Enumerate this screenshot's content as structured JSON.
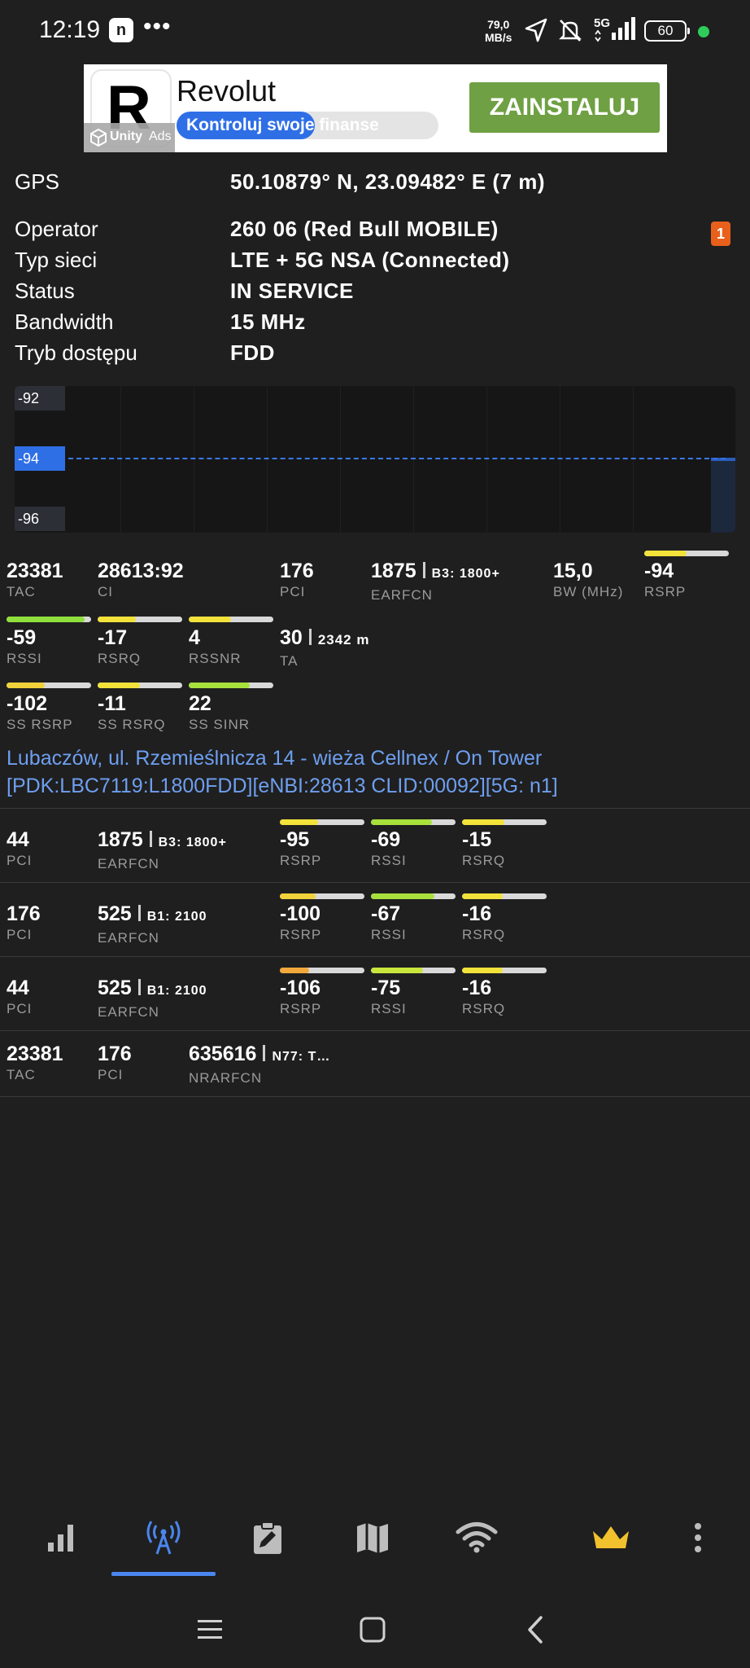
{
  "status_bar": {
    "time": "12:19",
    "app_icon_text": "n",
    "more": "•••",
    "speed_value": "79,0",
    "speed_unit": "MB/s",
    "network_label": "5G",
    "battery": "60",
    "icons": [
      "location-arrow-icon",
      "mute-icon",
      "signal-icon"
    ]
  },
  "ad": {
    "logo_letter": "R",
    "title": "Revolut",
    "tagline_a": "Kontroluj swoje",
    "tagline_b": " finanse",
    "badge_brand": "Unity",
    "badge_suffix": "Ads",
    "install_label": "ZAINSTALUJ",
    "install_color": "#6fa043"
  },
  "info": {
    "gps_label": "GPS",
    "gps_value": "50.10879° N, 23.09482° E (7 m)",
    "rows": [
      {
        "label": "Operator",
        "value": "260 06 (Red Bull MOBILE)"
      },
      {
        "label": "Typ sieci",
        "value": "LTE + 5G NSA (Connected)"
      },
      {
        "label": "Status",
        "value": "IN SERVICE"
      },
      {
        "label": "Bandwidth",
        "value": "15 MHz"
      },
      {
        "label": "Tryb dostępu",
        "value": "FDD"
      }
    ],
    "sim_badge": "1"
  },
  "graph": {
    "labels": [
      "-92",
      "-94",
      "-96"
    ],
    "active_label": "-94",
    "line_color": "#3a78e8"
  },
  "serving_cell": {
    "tac": {
      "value": "23381",
      "label": "TAC"
    },
    "ci": {
      "value": "28613:92",
      "label": "CI"
    },
    "pci": {
      "value": "176",
      "label": "PCI"
    },
    "earfcn": {
      "value": "1875",
      "band": "B3: 1800+",
      "label": "EARFCN"
    },
    "bw": {
      "value": "15,0",
      "label": "BW (MHz)"
    },
    "rsrp": {
      "value": "-94",
      "label": "RSRP",
      "level": 0.5,
      "color": "#f2e23a"
    },
    "rssi": {
      "value": "-59",
      "label": "RSSI",
      "level": 0.92,
      "color": "#8fe03c"
    },
    "rsrq": {
      "value": "-17",
      "label": "RSRQ",
      "level": 0.45,
      "color": "#f2e23a"
    },
    "rssnr": {
      "value": "4",
      "label": "RSSNR",
      "level": 0.5,
      "color": "#f2e23a"
    },
    "ta": {
      "value": "30",
      "distance": "2342 m",
      "label": "TA"
    },
    "ss_rsrp": {
      "value": "-102",
      "label": "SS RSRP",
      "level": 0.45,
      "color": "#f2d23a"
    },
    "ss_rsrq": {
      "value": "-11",
      "label": "SS RSRQ",
      "level": 0.5,
      "color": "#f2e23a"
    },
    "ss_sinr": {
      "value": "22",
      "label": "SS SINR",
      "level": 0.72,
      "color": "#a8e03c"
    }
  },
  "site": {
    "line1": "Lubaczów, ul. Rzemieślnicza 14 - wieża Cellnex / On Tower",
    "line2": "[PDK:LBC7119:L1800FDD][eNBI:28613 CLID:00092][5G: n1]"
  },
  "neighbors": [
    {
      "pci": "44",
      "pci_label": "PCI",
      "earfcn": "1875",
      "band": "B3: 1800+",
      "earfcn_label": "EARFCN",
      "rsrp": "-95",
      "rsrp_label": "RSRP",
      "rsrp_level": 0.45,
      "rsrp_color": "#f2e23a",
      "rssi": "-69",
      "rssi_label": "RSSI",
      "rssi_level": 0.72,
      "rssi_color": "#a8e03c",
      "rsrq": "-15",
      "rsrq_label": "RSRQ",
      "rsrq_level": 0.5,
      "rsrq_color": "#f2e23a"
    },
    {
      "pci": "176",
      "pci_label": "PCI",
      "earfcn": "525",
      "band": "B1: 2100",
      "earfcn_label": "EARFCN",
      "rsrp": "-100",
      "rsrp_label": "RSRP",
      "rsrp_level": 0.42,
      "rsrp_color": "#f2d23a",
      "rssi": "-67",
      "rssi_label": "RSSI",
      "rssi_level": 0.75,
      "rssi_color": "#a8e03c",
      "rsrq": "-16",
      "rsrq_label": "RSRQ",
      "rsrq_level": 0.48,
      "rsrq_color": "#f2e23a"
    },
    {
      "pci": "44",
      "pci_label": "PCI",
      "earfcn": "525",
      "band": "B1: 2100",
      "earfcn_label": "EARFCN",
      "rsrp": "-106",
      "rsrp_label": "RSRP",
      "rsrp_level": 0.35,
      "rsrp_color": "#f2a83a",
      "rssi": "-75",
      "rssi_label": "RSSI",
      "rssi_level": 0.62,
      "rssi_color": "#c8e63c",
      "rsrq": "-16",
      "rsrq_label": "RSRQ",
      "rsrq_level": 0.48,
      "rsrq_color": "#f2e23a"
    }
  ],
  "nr_cell": {
    "tac": "23381",
    "tac_label": "TAC",
    "pci": "176",
    "pci_label": "PCI",
    "nrarfcn": "635616",
    "band": "N77: T…",
    "nrarfcn_label": "NRARFCN"
  },
  "bottom_nav": {
    "items": [
      "signal-bars-icon",
      "cell-tower-icon",
      "clipboard-edit-icon",
      "map-icon",
      "wifi-icon",
      "crown-icon",
      "more-vertical-icon"
    ],
    "active_index": 1,
    "active_color": "#4a86f0",
    "crown_color": "#f2c12e"
  },
  "system_nav": [
    "menu-icon",
    "home-icon",
    "back-icon"
  ]
}
